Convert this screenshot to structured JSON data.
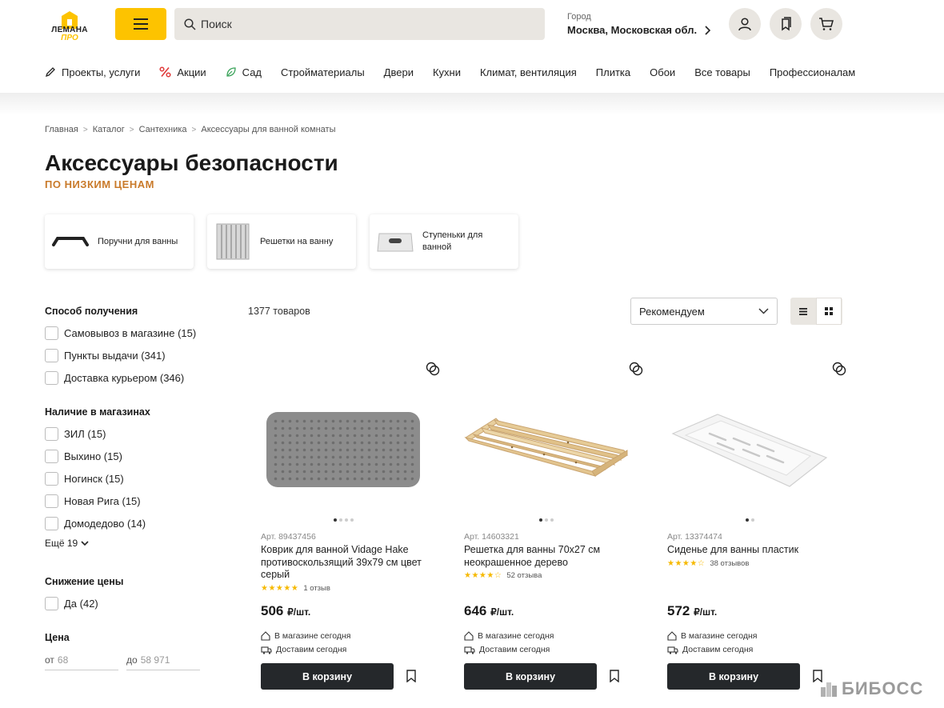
{
  "header": {
    "logo_line1": "ЛЕМАНА",
    "logo_line2": "ПРО",
    "search_placeholder": "Поиск",
    "city_label": "Город",
    "city_value": "Москва, Московская обл.",
    "brand_color": "#fdc300"
  },
  "nav": [
    {
      "label": "Проекты, услуги",
      "icon": "pencil-icon"
    },
    {
      "label": "Акции",
      "icon": "percent-icon"
    },
    {
      "label": "Сад",
      "icon": "leaf-icon"
    },
    {
      "label": "Стройматериалы"
    },
    {
      "label": "Двери"
    },
    {
      "label": "Кухни"
    },
    {
      "label": "Климат, вентиляция"
    },
    {
      "label": "Плитка"
    },
    {
      "label": "Обои"
    },
    {
      "label": "Все товары"
    },
    {
      "label": "Профессионалам"
    }
  ],
  "breadcrumb": [
    "Главная",
    "Каталог",
    "Сантехника",
    "Аксессуары для ванной комнаты"
  ],
  "page": {
    "title": "Аксессуары безопасности",
    "subtitle": "ПО НИЗКИМ ЦЕНАМ"
  },
  "categories": [
    {
      "label": "Поручни для ванны"
    },
    {
      "label": "Решетки на ванну"
    },
    {
      "label": "Ступеньки для ванной"
    }
  ],
  "filters": {
    "delivery": {
      "title": "Способ получения",
      "options": [
        "Самовывоз в магазине (15)",
        "Пункты выдачи (341)",
        "Доставка курьером (346)"
      ]
    },
    "stores": {
      "title": "Наличие в магазинах",
      "options": [
        "ЗИЛ (15)",
        "Выхино (15)",
        "Ногинск (15)",
        "Новая Рига (15)",
        "Домодедово (14)"
      ],
      "more": "Ещё 19"
    },
    "discount": {
      "title": "Снижение цены",
      "options": [
        "Да (42)"
      ]
    },
    "price": {
      "title": "Цена",
      "from_label": "от",
      "from_value": "68",
      "to_label": "до",
      "to_value": "58 971"
    }
  },
  "listing": {
    "count": "1377 товаров",
    "sort": "Рекомендуем"
  },
  "products": [
    {
      "art": "Арт. 89437456",
      "name": "Коврик для ванной Vidage Hake противоскользящий 39x79 см цвет серый",
      "stars": "★★★★★",
      "rating": 5,
      "reviews": "1 отзыв",
      "price": "506",
      "unit": "₽/шт.",
      "store": "В магазине сегодня",
      "delivery": "Доставим сегодня",
      "button": "В корзину",
      "image_dots": 4,
      "active_dot": 0
    },
    {
      "art": "Арт. 14603321",
      "name": "Решетка для ванны 70x27 см неокрашенное дерево",
      "stars": "★★★★☆",
      "rating": 3.5,
      "reviews": "52 отзыва",
      "price": "646",
      "unit": "₽/шт.",
      "store": "В магазине сегодня",
      "delivery": "Доставим сегодня",
      "button": "В корзину",
      "image_dots": 3,
      "active_dot": 0
    },
    {
      "art": "Арт. 13374474",
      "name": "Сиденье для ванны пластик",
      "stars": "★★★★☆",
      "rating": 3.5,
      "reviews": "38 отзывов",
      "price": "572",
      "unit": "₽/шт.",
      "store": "В магазине сегодня",
      "delivery": "Доставим сегодня",
      "button": "В корзину",
      "image_dots": 2,
      "active_dot": 0
    }
  ],
  "watermark": "БИБОСС"
}
